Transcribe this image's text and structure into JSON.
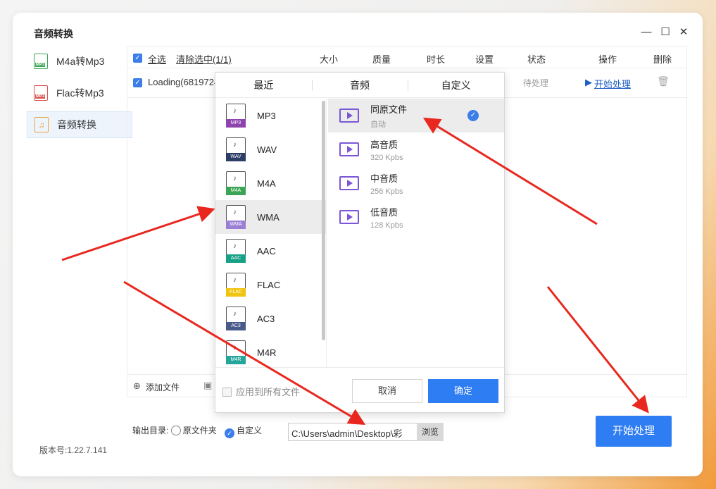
{
  "window": {
    "title": "音频转换"
  },
  "sidebar": {
    "items": [
      {
        "label": "M4a转Mp3",
        "badge": "MP3",
        "color": "#3aa655"
      },
      {
        "label": "Flac转Mp3",
        "badge": "MP3",
        "color": "#d9534f"
      },
      {
        "label": "音频转换",
        "badge": "♫",
        "color": "#e6a23c"
      }
    ]
  },
  "version": "版本号:1.22.7.141",
  "list": {
    "select_all": "全选",
    "clear": "清除选中(1/1)",
    "columns": [
      "大小",
      "质量",
      "时长",
      "设置",
      "状态",
      "操作",
      "删除"
    ],
    "row": {
      "name": "Loading(6819724",
      "status": "待处理",
      "action": "开始处理"
    },
    "add_file": "添加文件"
  },
  "output": {
    "label": "输出目录:",
    "opt_source": "原文件夹",
    "opt_custom": "自定义",
    "path": "C:\\Users\\admin\\Desktop\\彩",
    "browse": "浏览"
  },
  "start_button": "开始处理",
  "popup": {
    "tabs": [
      "最近",
      "音频",
      "自定义"
    ],
    "formats": [
      {
        "name": "MP3",
        "color": "#8e44ad"
      },
      {
        "name": "WAV",
        "color": "#2c3e66"
      },
      {
        "name": "M4A",
        "color": "#3aa655"
      },
      {
        "name": "WMA",
        "color": "#9b7fd4"
      },
      {
        "name": "AAC",
        "color": "#16a085"
      },
      {
        "name": "FLAC",
        "color": "#f1c40f"
      },
      {
        "name": "AC3",
        "color": "#4a5a8a"
      },
      {
        "name": "M4R",
        "color": "#26a69a"
      }
    ],
    "qualities": [
      {
        "name": "同原文件",
        "sub": "自动"
      },
      {
        "name": "高音质",
        "sub": "320 Kpbs"
      },
      {
        "name": "中音质",
        "sub": "256 Kpbs"
      },
      {
        "name": "低音质",
        "sub": "128 Kpbs"
      }
    ],
    "apply_all": "应用到所有文件",
    "cancel": "取消",
    "ok": "确定"
  }
}
